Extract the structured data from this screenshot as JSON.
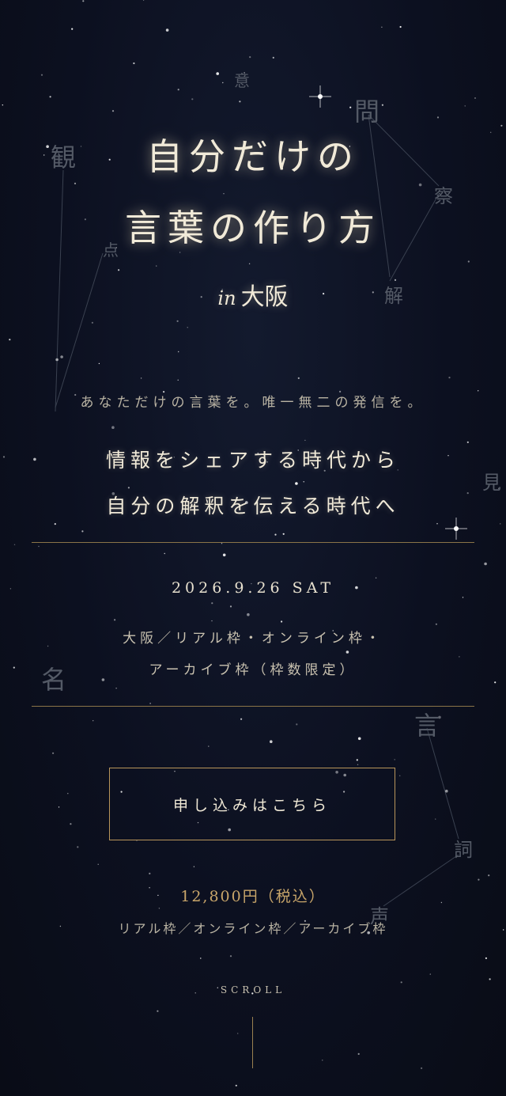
{
  "title_lines": [
    "自分だけの",
    "言葉の作り方"
  ],
  "subtitle": {
    "prefix": "in",
    "place": "大阪"
  },
  "tagline": "あなただけの言葉を。唯一無二の発信を。",
  "lead_lines": [
    "情報をシェアする時代から",
    "自分の解釈を伝える時代へ"
  ],
  "event": {
    "date": "2026.9.26 SAT",
    "venue_lines": [
      "大阪／リアル枠・オンライン枠・",
      "アーカイブ枠（枠数限定）"
    ]
  },
  "cta": {
    "label": "申し込みはこちら"
  },
  "price": {
    "amount": "12,800円（税込）",
    "note": "リアル枠／オンライン枠／アーカイブ枠"
  },
  "scroll_label": "SCROLL",
  "background_kanji": [
    "意",
    "問",
    "観",
    "察",
    "点",
    "解",
    "見",
    "名",
    "言",
    "詞",
    "声"
  ],
  "colors": {
    "background": "#0c0f1a",
    "gold": "#b8955a",
    "price": "#c9a66a",
    "text": "#f1ead8"
  }
}
